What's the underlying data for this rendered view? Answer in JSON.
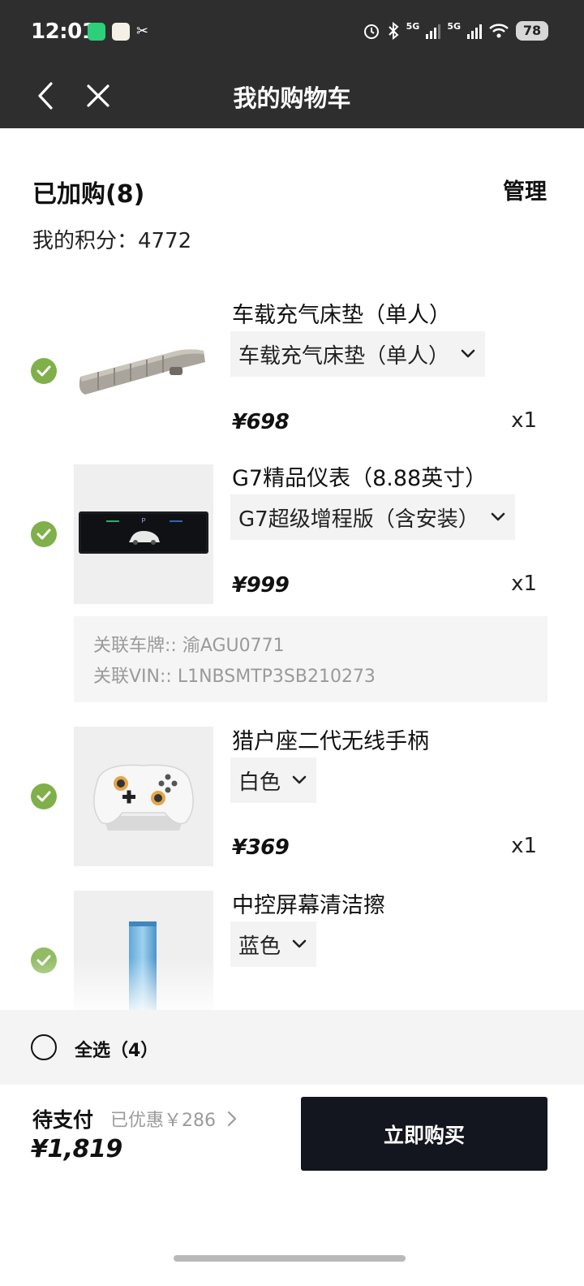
{
  "status_bar": {
    "time": "12:01",
    "battery": "78",
    "signal_label_1": "5G",
    "signal_label_2": "5G"
  },
  "header": {
    "title": "我的购物车",
    "back_icon": "chevron-left-icon",
    "close_icon": "close-icon"
  },
  "summary": {
    "cart_count": "已加购(8)",
    "manage_label": "管理",
    "points_label": "我的积分：",
    "points_value": "4772"
  },
  "items": [
    {
      "name": "车载充气床垫（单人）",
      "variant": "车载充气床垫（单人）",
      "price": "¥698",
      "qty": "x1",
      "checked": true
    },
    {
      "name": "G7精品仪表（8.88英寸）",
      "variant": "G7超级增程版（含安装）",
      "price": "¥999",
      "qty": "x1",
      "checked": true,
      "plate_label": "关联车牌::",
      "plate_value": "渝AGU0771",
      "vin_label": "关联VIN::",
      "vin_value": "L1NBSMTP3SB210273"
    },
    {
      "name": "猎户座二代无线手柄",
      "variant": "白色",
      "price": "¥369",
      "qty": "x1",
      "checked": true
    },
    {
      "name": "中控屏幕清洁擦",
      "variant": "蓝色",
      "checked": true
    }
  ],
  "select_all": {
    "label": "全选（4）",
    "checked": false
  },
  "footer": {
    "pay_label": "待支付",
    "discount": "已优惠￥286",
    "total": "¥1,819",
    "buy_label": "立即购买"
  },
  "colors": {
    "header_bg": "#2e2e2e",
    "check_green": "#7fb04a",
    "buy_button_bg": "#13161e"
  }
}
